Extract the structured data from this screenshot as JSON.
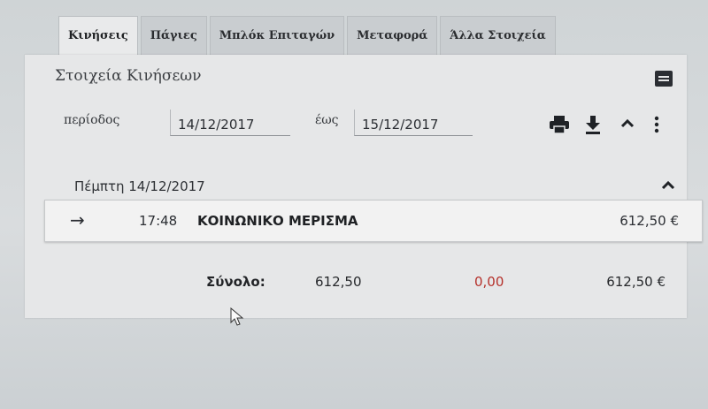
{
  "tabs": [
    {
      "label": "Κινήσεις",
      "active": true
    },
    {
      "label": "Πάγιες",
      "active": false
    },
    {
      "label": "Μπλόκ Επιταγών",
      "active": false
    },
    {
      "label": "Μεταφορά",
      "active": false
    },
    {
      "label": "Άλλα Στοιχεία",
      "active": false
    }
  ],
  "panel": {
    "title": "Στοιχεία Κινήσεων",
    "filter": {
      "period_label": "περίοδος",
      "from_value": "14/12/2017",
      "to_label": "έως",
      "to_value": "15/12/2017"
    },
    "toolbar": {
      "icons": [
        "print-icon",
        "download-icon",
        "chevron-up-icon",
        "more-vertical-icon"
      ]
    },
    "day_group": {
      "label": "Πέμπτη 14/12/2017",
      "transactions": [
        {
          "direction": "→",
          "time": "17:48",
          "description": "ΚΟΙΝΩΝΙΚΟ ΜΕΡΙΣΜΑ",
          "amount": "612,50 €"
        }
      ]
    },
    "totals": {
      "label": "Σύνολο:",
      "credit": "612,50",
      "debit": "0,00",
      "balance": "612,50 €"
    }
  },
  "colors": {
    "debit": "#b5312b",
    "panel_bg": "#e6e7e8"
  }
}
